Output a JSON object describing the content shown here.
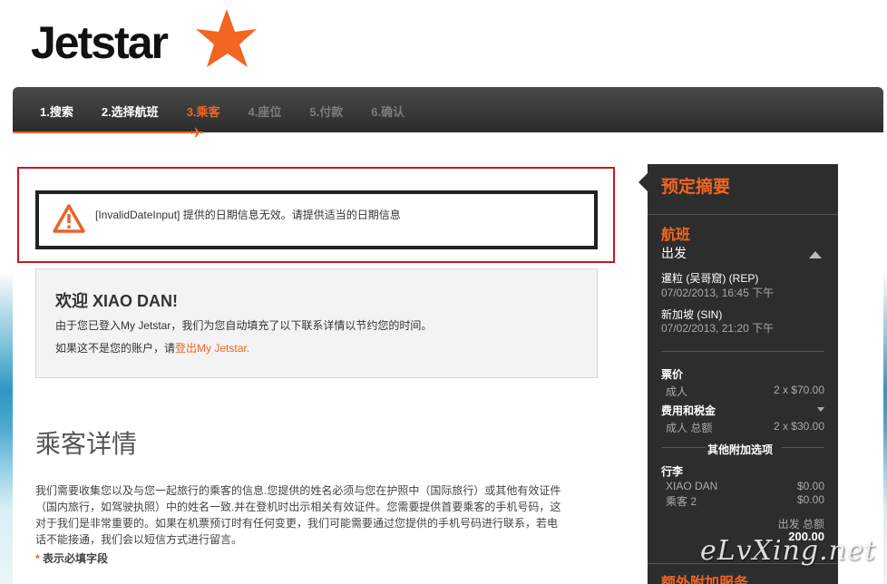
{
  "brand": {
    "logo_text": "Jetstar"
  },
  "nav": {
    "steps": [
      {
        "label": "1.搜索"
      },
      {
        "label": "2.选择航班"
      },
      {
        "label": "3.乘客"
      },
      {
        "label": "4.座位"
      },
      {
        "label": "5.付款"
      },
      {
        "label": "6.确认"
      }
    ],
    "active_index": 2
  },
  "error": {
    "message": "[InvalidDateInput] 提供的日期信息无效。请提供适当的日期信息"
  },
  "welcome": {
    "heading": "欢迎 XIAO DAN!",
    "line1": "由于您已登入My Jetstar，我们为您自动填充了以下联系详情以节约您的时间。",
    "line2_prefix": "如果这不是您的账户，请",
    "logout_link": "登出My Jetstar."
  },
  "passenger_details": {
    "title": "乘客详情",
    "body": "我们需要收集您以及与您一起旅行的乘客的信息.您提供的姓名必须与您在护照中（国际旅行）或其他有效证件（国内旅行，如驾驶执照）中的姓名一致.并在登机时出示相关有效证件。您需要提供首要乘客的手机号码，这对于我们是非常重要的。如果在机票预订时有任何变更，我们可能需要通过您提供的手机号码进行联系，若电话不能接通，我们会以短信方式进行留言。",
    "required_star": "*",
    "required_label": "表示必填字段"
  },
  "summary": {
    "title": "预定摘要",
    "flight_head": "航班",
    "depart_label": "出发",
    "origin": "暹粒 (吴哥窟) (REP)",
    "origin_time": "07/02/2013, 16:45 下午",
    "destination": "新加坡 (SIN)",
    "destination_time": "07/02/2013, 21:20 下午",
    "fare_head": "票价",
    "adult_label": "成人",
    "adult_qty": "2",
    "adult_price": "$70.00",
    "fees_head": "费用和税金",
    "fees_label": "成人 总额",
    "fees_qty": "2",
    "fees_price": "$30.00",
    "addons_head": "其他附加选项",
    "baggage_head": "行李",
    "bag1_name": "XIAO DAN",
    "bag1_price": "$0.00",
    "bag2_name": "乘客 2",
    "bag2_price": "$0.00",
    "total_label": "出发 总额",
    "total_value": "200.00",
    "extra_head": "额外附加服务"
  },
  "watermark": "eLvXing.net"
}
